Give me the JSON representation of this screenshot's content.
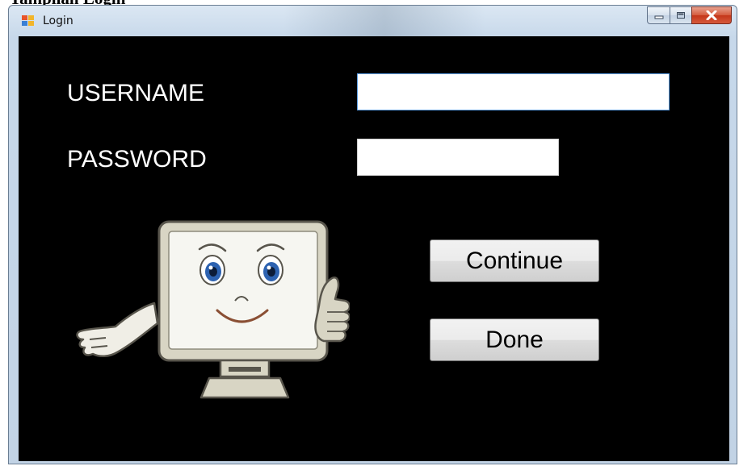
{
  "document": {
    "caption": "Tampilan Login"
  },
  "window": {
    "title": "Login",
    "app_icon": "windows-form-icon",
    "controls": {
      "minimize_icon": "minimize-icon",
      "maximize_icon": "maximize-icon",
      "close_icon": "close-icon"
    }
  },
  "form": {
    "background_color": "#000000",
    "username": {
      "label": "USERNAME",
      "value": ""
    },
    "password": {
      "label": "PASSWORD",
      "value": ""
    },
    "mascot_icon": "computer-mascot-thumbs-up-icon",
    "buttons": {
      "continue_label": "Continue",
      "done_label": "Done"
    }
  }
}
